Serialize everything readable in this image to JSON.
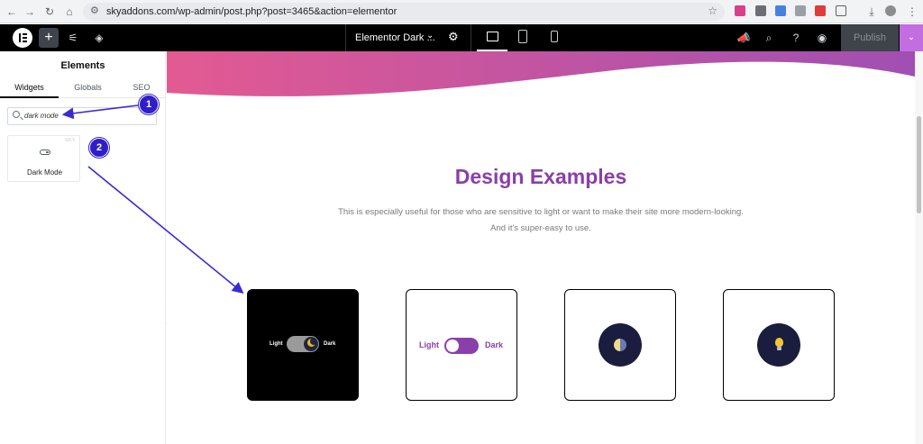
{
  "browser": {
    "url": "skyaddons.com/wp-admin/post.php?post=3465&action=elementor"
  },
  "editor": {
    "document_title": "Elementor Dark ...",
    "publish_label": "Publish"
  },
  "panel": {
    "title": "Elements",
    "tabs": [
      {
        "label": "Widgets",
        "active": true
      },
      {
        "label": "Globals",
        "active": false
      },
      {
        "label": "SEO",
        "active": false
      }
    ],
    "search_value": "dark mode",
    "widget": {
      "label": "Dark Mode",
      "badge": "SKY"
    }
  },
  "canvas": {
    "heading": "Design Examples",
    "subtitle_line1": "This is especially useful for those who are sensitive to light or want to make their site more modern-looking.",
    "subtitle_line2": "And it's super-easy to use.",
    "demos": [
      {
        "style": "dark",
        "light_label": "Light",
        "dark_label": "Dark"
      },
      {
        "style": "light",
        "light_label": "Light",
        "dark_label": "Dark"
      },
      {
        "style": "half-circle-icon"
      },
      {
        "style": "bulb-icon"
      }
    ],
    "wave_gradient": [
      "#e35a92",
      "#a04fb2"
    ]
  },
  "annotations": [
    {
      "number": "1"
    },
    {
      "number": "2"
    }
  ],
  "colors": {
    "accent_purple": "#8a3fa9",
    "annotation_blue": "#2f1ec8",
    "elementor_pink": "#c36ee0"
  }
}
